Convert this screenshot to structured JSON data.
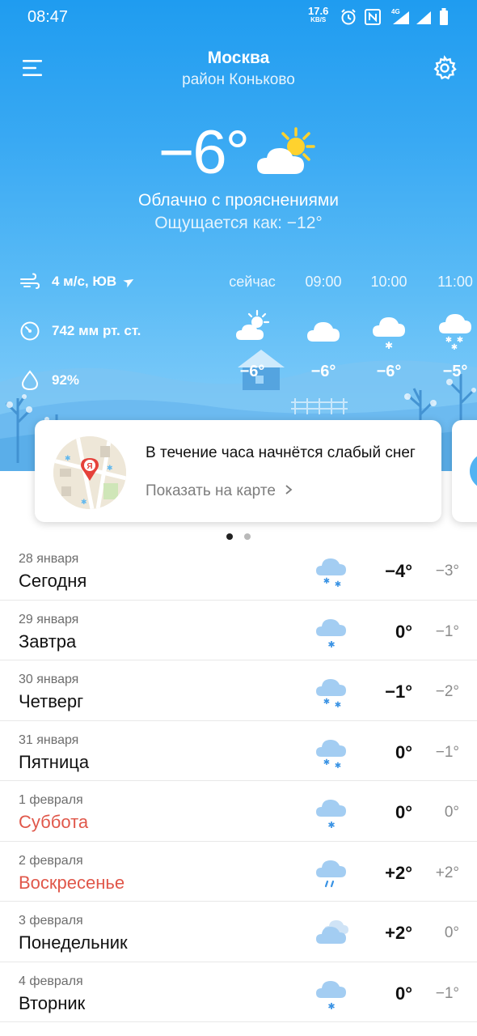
{
  "status_bar": {
    "time": "08:47",
    "net_speed": "17.6",
    "net_unit": "KB/S",
    "net_type": "4G",
    "icons": [
      "alarm-icon",
      "nfc-icon",
      "signal-icon",
      "signal-icon",
      "battery-icon"
    ]
  },
  "header": {
    "city": "Москва",
    "district": "район Коньково",
    "menu_icon": "hamburger-menu-icon",
    "settings_icon": "gear-icon"
  },
  "current": {
    "temperature": "−6°",
    "icon": "partly-cloudy-day-icon",
    "condition": "Облачно с прояснениями",
    "feels_like": "Ощущается как: −12°"
  },
  "details": {
    "wind": "4 м/с, ЮВ",
    "pressure": "742 мм рт. ст.",
    "humidity": "92%"
  },
  "hourly": [
    {
      "time": "сейчас",
      "icon": "partly-cloudy-day-icon",
      "temp": "−6°"
    },
    {
      "time": "09:00",
      "icon": "cloudy-icon",
      "temp": "−6°"
    },
    {
      "time": "10:00",
      "icon": "light-snow-icon",
      "temp": "−6°"
    },
    {
      "time": "11:00",
      "icon": "snow-icon",
      "temp": "−5°"
    }
  ],
  "nowcast_card": {
    "text": "В течение часа начнётся слабый снег",
    "link": "Показать на карте",
    "map_badge": "Я"
  },
  "pager": {
    "active": 1,
    "total": 2
  },
  "colors": {
    "sky_top": "#1f9cf0",
    "sky_bottom": "#8fd2fa",
    "weekend": "#e0574a",
    "secondary_text": "#8a8a8a"
  },
  "daily": [
    {
      "date": "28 января",
      "day": "Сегодня",
      "weekend": false,
      "icon": "snow-icon",
      "hi": "−4°",
      "lo": "−3°"
    },
    {
      "date": "29 января",
      "day": "Завтра",
      "weekend": false,
      "icon": "light-snow-icon",
      "hi": "0°",
      "lo": "−1°"
    },
    {
      "date": "30 января",
      "day": "Четверг",
      "weekend": false,
      "icon": "snow-icon",
      "hi": "−1°",
      "lo": "−2°"
    },
    {
      "date": "31 января",
      "day": "Пятница",
      "weekend": false,
      "icon": "snow-icon",
      "hi": "0°",
      "lo": "−1°"
    },
    {
      "date": "1 февраля",
      "day": "Суббота",
      "weekend": true,
      "icon": "light-snow-icon",
      "hi": "0°",
      "lo": "0°"
    },
    {
      "date": "2 февраля",
      "day": "Воскресенье",
      "weekend": true,
      "icon": "rain-icon",
      "hi": "+2°",
      "lo": "+2°"
    },
    {
      "date": "3 февраля",
      "day": "Понедельник",
      "weekend": false,
      "icon": "overcast-icon",
      "hi": "+2°",
      "lo": "0°"
    },
    {
      "date": "4 февраля",
      "day": "Вторник",
      "weekend": false,
      "icon": "light-snow-icon",
      "hi": "0°",
      "lo": "−1°"
    }
  ]
}
